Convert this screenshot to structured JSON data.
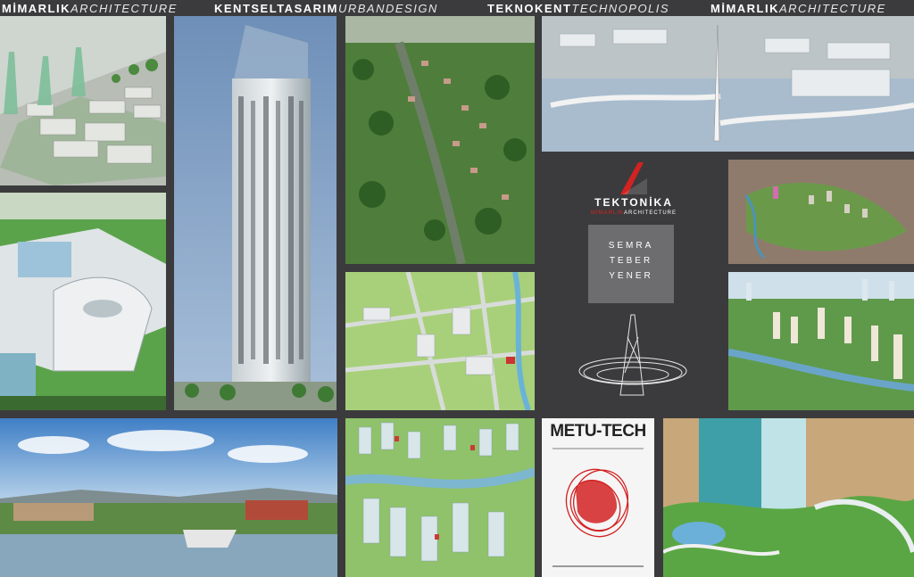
{
  "header": {
    "segments": [
      {
        "bold": "MİMARLIK",
        "italic": "ARCHITECTURE"
      },
      {
        "bold": "KENTSELTASARIM",
        "italic": "URBANDESIGN"
      },
      {
        "bold": "TEKNOKENT",
        "italic": "TECHNOPOLIS"
      },
      {
        "bold": "MİMARLIK",
        "italic": "ARCHITECTURE"
      }
    ]
  },
  "logo": {
    "name": "TEKTONİKA",
    "sub_red": "MİMARLIK",
    "sub_white": "ARCHITECTURE"
  },
  "people": [
    "SEMRA",
    "TEBER",
    "YENER"
  ],
  "poster": {
    "title": "METU-TECH"
  },
  "colors": {
    "background": "#3b3b3d",
    "accent_red": "#d22222",
    "name_box": "#6d6d6f"
  },
  "tiles": [
    "masterplan-towers-image",
    "skyscraper-image",
    "residential-forest-image",
    "waterfront-tower-image",
    "technopark-building-image",
    "campus-plan-image",
    "valley-residential-image",
    "river-towers-image",
    "coastal-panorama-image",
    "residential-blocks-image",
    "metu-tech-poster-image",
    "tower-podium-image"
  ]
}
